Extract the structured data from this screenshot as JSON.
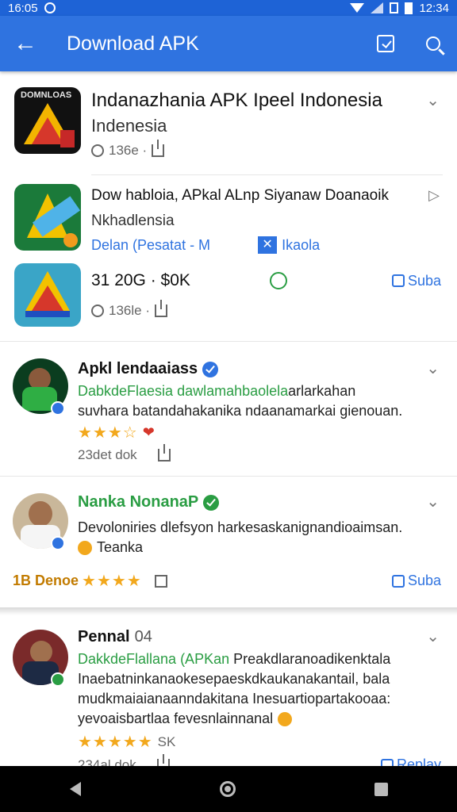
{
  "status_bar": {
    "left_time": "16:05",
    "right_time": "12:34"
  },
  "app_bar": {
    "title": "Download APK"
  },
  "apps": [
    {
      "icon_text": "DOMNLOAS",
      "title": "Indanazhania APK Ipeel Indonesia",
      "subtitle": "Indenesia",
      "meta": "136e ·"
    },
    {
      "title": "Dow habloia, APkal ALnp Siyanaw Doanaoik",
      "subtitle": "Nkhadlensia",
      "link_left": "Delan (Pesatat - M",
      "link_right": "Ikaola"
    },
    {
      "title": "31 20G · $0K",
      "meta": "136le ·",
      "like_label": "Suba"
    }
  ],
  "reviews": [
    {
      "name": "Apkl lendaaiass",
      "highlight": "DabkdeFlaesia dawlamahbaolela",
      "body1": "arlarkahan",
      "body2": "suvhara batandahakanika ndaanamarkai gienouan.",
      "stars": "★★★☆",
      "meta": "23det dok"
    },
    {
      "name": "Nanka NonanaP",
      "body1": "Devoloniries dlefsyon harkesaskanignandioaimsan.",
      "body2": "Teanka",
      "rating_prefix": "1B Denoe",
      "stars": "★★★★",
      "like_label": "Suba"
    },
    {
      "name": "Pennal",
      "name_suffix": "04",
      "highlight": "DakkdeFlallana (APKan",
      "body1": "Preakdlaranoadikenktala",
      "body2": "Inaebatninkanaokesepaeskdkaukanakantail, bala",
      "body3": "mudkmaiaianaanndakitana Inesuartiopartakooaa:",
      "body4": "yevoaisbartlaa fevesnlainnanal",
      "stars": "★★★★★",
      "star_suffix": "SK",
      "meta": "234al dok",
      "like_label": "Replay"
    }
  ]
}
